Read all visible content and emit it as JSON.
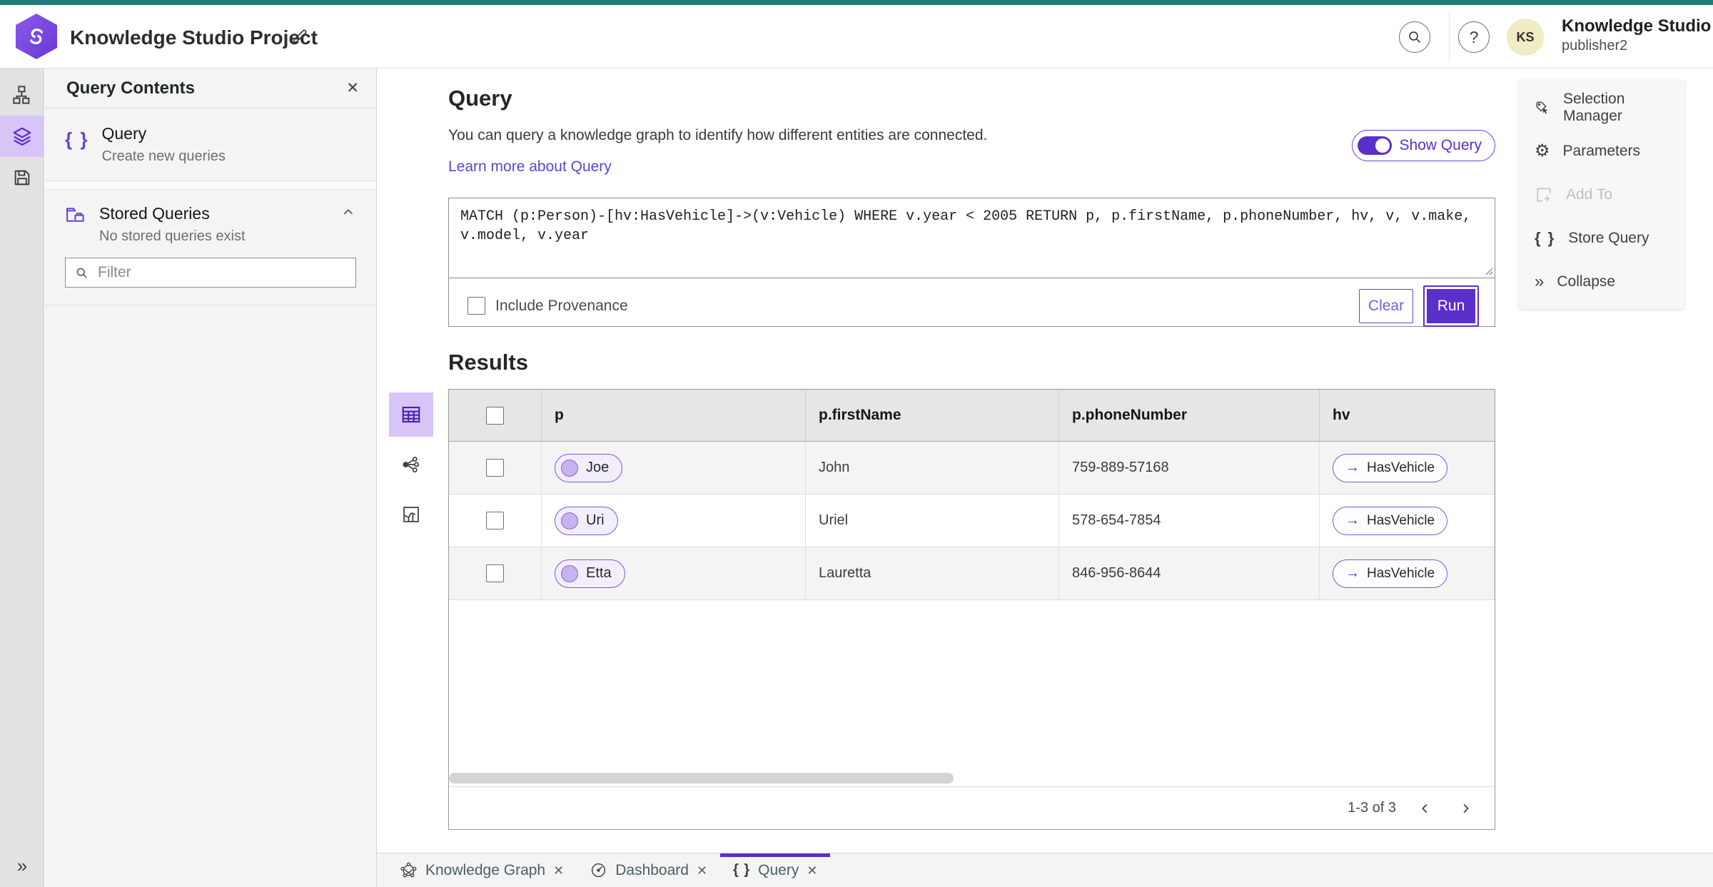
{
  "header": {
    "app_title": "Knowledge Studio Project",
    "user_name": "Knowledge Studio",
    "user_role": "publisher2",
    "avatar_initials": "KS",
    "help_glyph": "?"
  },
  "sidebar": {
    "panel_title": "Query Contents",
    "items": [
      {
        "title": "Query",
        "subtitle": "Create new queries"
      },
      {
        "title": "Stored Queries",
        "subtitle": "No stored queries exist"
      }
    ],
    "filter_placeholder": "Filter"
  },
  "query": {
    "title": "Query",
    "description": "You can query a knowledge graph to identify how different entities are connected.",
    "learn_more": "Learn more about Query",
    "show_query_label": "Show Query",
    "query_text": "MATCH (p:Person)-[hv:HasVehicle]->(v:Vehicle) WHERE v.year < 2005 RETURN p, p.firstName, p.phoneNumber, hv, v, v.make, v.model, v.year",
    "include_provenance_label": "Include Provenance",
    "clear_label": "Clear",
    "run_label": "Run"
  },
  "side_menu": {
    "items": [
      {
        "label": "Selection Manager"
      },
      {
        "label": "Parameters"
      },
      {
        "label": "Add To"
      },
      {
        "label": "Store Query"
      },
      {
        "label": "Collapse"
      }
    ]
  },
  "results": {
    "title": "Results",
    "columns": [
      "p",
      "p.firstName",
      "p.phoneNumber",
      "hv"
    ],
    "rows": [
      {
        "p": "Joe",
        "firstName": "John",
        "phoneNumber": "759-889-57168",
        "hv": "HasVehicle"
      },
      {
        "p": "Uri",
        "firstName": "Uriel",
        "phoneNumber": "578-654-7854",
        "hv": "HasVehicle"
      },
      {
        "p": "Etta",
        "firstName": "Lauretta",
        "phoneNumber": "846-956-8644",
        "hv": "HasVehicle"
      }
    ],
    "pagination_label": "1-3 of 3"
  },
  "tabs": [
    {
      "label": "Knowledge Graph",
      "active": false
    },
    {
      "label": "Dashboard",
      "active": false
    },
    {
      "label": "Query",
      "active": true
    }
  ],
  "icons": {
    "close": "✕",
    "collapse_rail": "»",
    "braces": "{ }",
    "arrow_right": "→",
    "gear": "⚙",
    "side_menu_collapse": "»"
  },
  "colors": {
    "top_strip": "#287879",
    "accent": "#5b2fc9",
    "accent_border": "#6d3fd1",
    "pill_border": "#7e57d2",
    "pill_fill": "#f3eefc",
    "node_circle": "#c7b2f2",
    "link": "#5c46cf",
    "selected_rail_bg": "#d7c5f7",
    "avatar_bg": "#f0ecc3"
  }
}
